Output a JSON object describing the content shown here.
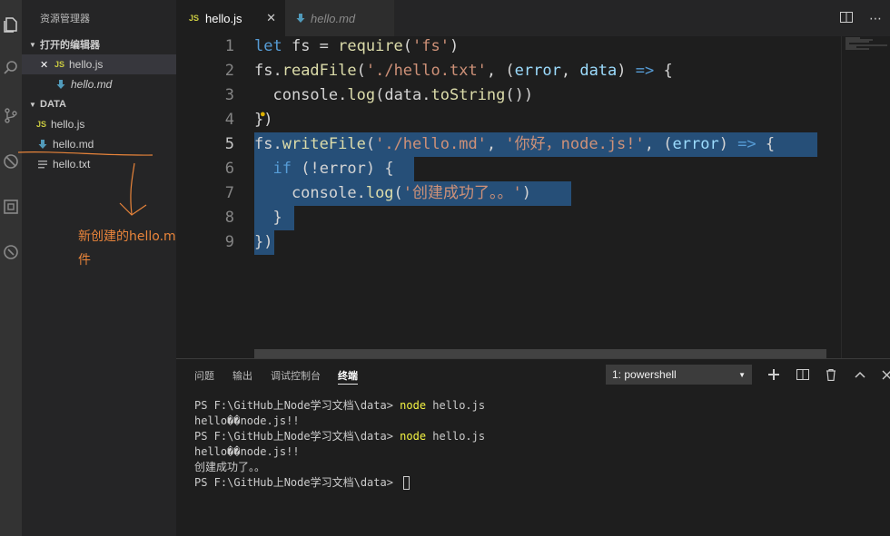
{
  "sidebar": {
    "title": "资源管理器",
    "open_editors": {
      "label": "打开的编辑器",
      "items": [
        {
          "close": "✕",
          "badge": "JS",
          "name": "hello.js"
        },
        {
          "name": "hello.md"
        }
      ]
    },
    "folder": {
      "label": "DATA",
      "files": [
        {
          "badge": "JS",
          "name": "hello.js"
        },
        {
          "name": "hello.md"
        },
        {
          "name": "hello.txt"
        }
      ]
    }
  },
  "annotation": {
    "line1": "新创建的hello.md文",
    "line2": "件"
  },
  "tabs": [
    {
      "badge": "JS",
      "label": "hello.js",
      "close": "✕"
    },
    {
      "label": "hello.md"
    }
  ],
  "editor": {
    "line_numbers": [
      "1",
      "2",
      "3",
      "4",
      "5",
      "6",
      "7",
      "8",
      "9"
    ],
    "current_line": 5,
    "code": {
      "l1": {
        "kw": "let",
        "var": " fs = ",
        "fn": "require",
        "p1": "(",
        "str": "'fs'",
        "p2": ")"
      },
      "l2": {
        "a": "fs.",
        "fn": "readFile",
        "p1": "(",
        "str": "'./hello.txt'",
        "b": ", ",
        "p2": "(",
        "prm1": "error",
        "c": ", ",
        "prm2": "data",
        "p3": ")",
        "arrow": " => ",
        "d": "{"
      },
      "l3": {
        "a": "  console.",
        "fn": "log",
        "p1": "(",
        "b": "data.",
        "fn2": "toString",
        "p2": "())"
      },
      "l4": {
        "a": "})"
      },
      "l5": {
        "a": "fs.",
        "fn": "writeFile",
        "p1": "(",
        "str1": "'./hello.md'",
        "b": ", ",
        "str2": "'你好，node.js!'",
        "c": ", ",
        "p2": "(",
        "prm": "error",
        "p3": ")",
        "arrow": " => ",
        "d": "{"
      },
      "l6": {
        "a": "  ",
        "kw": "if",
        "b": " ",
        "p1": "(",
        "c": "!error",
        "p2": ")",
        "d": " {"
      },
      "l7": {
        "a": "    console.",
        "fn": "log",
        "p1": "(",
        "str": "'创建成功了。。'",
        "p2": ")"
      },
      "l8": {
        "a": "  }"
      },
      "l9": {
        "a": "})"
      }
    }
  },
  "panel": {
    "tabs": [
      "问题",
      "输出",
      "调试控制台",
      "终端"
    ],
    "active_tab": "终端",
    "terminal_select": "1: powershell",
    "actions": [
      "+",
      "split",
      "trash",
      "chevron-up",
      "close"
    ],
    "lines": [
      {
        "prompt": "PS F:\\GitHub上Node学习文档\\data> ",
        "cmd": "node",
        "rest": " hello.js"
      },
      {
        "text": "hello��node.js!!"
      },
      {
        "prompt": "PS F:\\GitHub上Node学习文档\\data> ",
        "cmd": "node",
        "rest": " hello.js"
      },
      {
        "text": "hello��node.js!!"
      },
      {
        "text": "创建成功了。。"
      },
      {
        "prompt": "PS F:\\GitHub上Node学习文档\\data> "
      }
    ]
  }
}
